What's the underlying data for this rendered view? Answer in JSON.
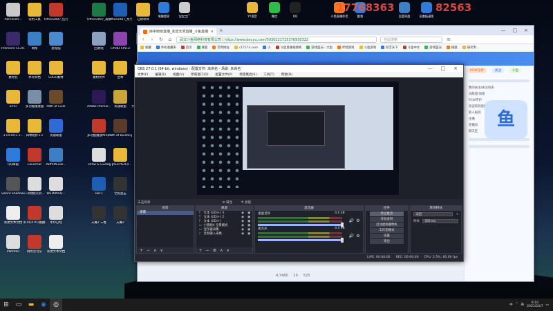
{
  "desktop": {
    "icons": [
      {
        "label": "Administr...",
        "color": "#c9c9c9"
      },
      {
        "label": "常用工具",
        "color": "#e8b938"
      },
      {
        "label": "Office2007_红打印机",
        "color": "#c0392b"
      },
      {
        "label": "Office2007_表格",
        "color": "#1d7a45"
      },
      {
        "label": "Office2007_文字",
        "color": "#1e5fb5"
      },
      {
        "label": "已建项目",
        "color": "#e8b938"
      },
      {
        "label": "Premiere CC2019",
        "color": "#3a2a6a"
      },
      {
        "label": "网络",
        "color": "#3c7fc4"
      },
      {
        "label": "此电脑",
        "color": "#4a8bd0"
      },
      {
        "label": "回收站",
        "color": "#8aa2bf"
      },
      {
        "label": "CPUID CPU-Z",
        "color": "#8e44ad"
      },
      {
        "label": "version",
        "color": "#2f7bdc"
      },
      {
        "label": "素材包",
        "color": "#e8b938"
      },
      {
        "label": "水印文档",
        "color": "#e8b938"
      },
      {
        "label": "LOGO素材",
        "color": "#e8b938"
      },
      {
        "label": "素材文件",
        "color": "#e8b938"
      },
      {
        "label": "台本",
        "color": "#e8b938"
      },
      {
        "label": "成片",
        "color": "#e8b938"
      },
      {
        "label": "error",
        "color": "#e8b938"
      },
      {
        "label": "多功能播放器",
        "color": "#7b8ea8"
      },
      {
        "label": "Path of Exile",
        "color": "#6b4a2a"
      },
      {
        "label": "Adobe Premie...",
        "color": "#2b1a55"
      },
      {
        "label": "英雄联盟",
        "color": "#c9a53a"
      },
      {
        "label": "文字过滤下载地址",
        "color": "#e8b938"
      },
      {
        "label": "3.14.0c(3.1...",
        "color": "#e8b938"
      },
      {
        "label": "四季防护3.1",
        "color": "#e8b938"
      },
      {
        "label": "英雄联盟",
        "color": "#2f6bd6"
      },
      {
        "label": "多功能播放AH(20.19...",
        "color": "#c0392b"
      },
      {
        "label": "Path of Building",
        "color": "#5a3a2a"
      },
      {
        "label": "PoeCharm",
        "color": "#c0392b"
      },
      {
        "label": "QQ邮箱",
        "color": "#2f7bdc"
      },
      {
        "label": "Launcher",
        "color": "#c0392b"
      },
      {
        "label": "PathOfExile...",
        "color": "#3c7fc4"
      },
      {
        "label": "Draw & Guess",
        "color": "#ddd"
      },
      {
        "label": "g.p%2F%2F(I...",
        "color": "#e8b938"
      },
      {
        "label": "QQ 浏览器",
        "color": "#2f7bdc"
      },
      {
        "label": "Sekiro Shadows",
        "color": "#555"
      },
      {
        "label": "~$网络识别...",
        "color": "#ddd"
      },
      {
        "label": "WEIXINGQ...",
        "color": "#ddd"
      },
      {
        "label": "Doc1",
        "color": "#1e5fb5"
      },
      {
        "label": "全民狙击",
        "color": "#333"
      },
      {
        "label": "For Honor",
        "color": "#8b1e1e"
      },
      {
        "label": "新建文本文档",
        "color": "#eee"
      },
      {
        "label": "(8.0)(4.01)麒麟...",
        "color": "#c0392b"
      },
      {
        "label": "水印已经",
        "color": "#ddd"
      },
      {
        "label": "天翼2 三维",
        "color": "#333"
      },
      {
        "label": "天翼2",
        "color": "#333"
      },
      {
        "label": "芒果TV",
        "color": "#f08a24"
      },
      {
        "label": "PW0000",
        "color": "#ddd"
      },
      {
        "label": "网易云音乐",
        "color": "#c0392b"
      },
      {
        "label": "新建文本文档",
        "color": "#eee"
      }
    ],
    "top_icons": [
      {
        "label": "电脑管家",
        "color": "#2f7bdc"
      },
      {
        "label": "宝宝工厂",
        "color": "#cccccc"
      },
      {
        "label": "YY语音",
        "color": "#e8b938"
      },
      {
        "label": "微信",
        "color": "#2dbb4e"
      },
      {
        "label": "QQ",
        "color": "#222222"
      },
      {
        "label": "斗鱼直播伴侣",
        "color": "#f27a1a"
      },
      {
        "label": "酷我",
        "color": "#2f7bdc"
      },
      {
        "label": "百度网盘",
        "color": "#3c7fc4"
      },
      {
        "label": "迅雷极速版",
        "color": "#2f7bdc"
      }
    ],
    "overlay_text_1": "17768363",
    "overlay_text_2": "82563"
  },
  "browser": {
    "tab_title": "房中晓晓直播_永劫无间直播_斗鱼直播",
    "url": "武汉斗鱼网络科技有限公司 | https://www.douyu.com/5030221715376930322",
    "search_placeholder": "在此搜索",
    "bookmarks": [
      "收藏",
      "手机收藏夹",
      "首页",
      "搜狐",
      "常用网址",
      "c17173.com",
      "小",
      "斗鱼直播视频网",
      "游戏盛况 - 大鱼",
      "哔哩游戏",
      "斗鱼游戏",
      "综艺天下",
      "斗鱼中文",
      "游戏盛况",
      "搜狐",
      "研究专..."
    ],
    "side_text": [
      "我的关注/关注列表",
      "贡献值/周榜",
      "PCW守护",
      "欢迎来到直播间",
      "新人报到",
      "主播",
      "直播间",
      "聊天区"
    ],
    "side_pills": [
      "PCW守护",
      "关注",
      "斗鱼"
    ],
    "big_logo": "鱼",
    "footer": [
      "4,7486",
      "20",
      "520"
    ]
  },
  "obs": {
    "title": "OBS 27.0.1 (64-bit, windows) - 配置文件: 未命名 - 场景: 未命名",
    "menu": [
      "文件(F)",
      "编辑(E)",
      "视图(V)",
      "停靠窗口(D)",
      "配置文件(P)",
      "场景集合(S)",
      "工具(T)",
      "帮助(H)"
    ],
    "no_source": "未选择源",
    "props_label": "属性",
    "filter_label": "滤镜",
    "docks": {
      "scenes": {
        "title": "场景",
        "items": [
          "场景"
        ]
      },
      "sources": {
        "title": "来源",
        "items": [
          {
            "icon": "T",
            "label": "文本 (GDI+) 3"
          },
          {
            "icon": "T",
            "label": "文本 (GDI+) 2"
          },
          {
            "icon": "T",
            "label": "文本 (GDI+)"
          },
          {
            "icon": "▭",
            "label": "小钢炮4 全景模式"
          },
          {
            "icon": "▭",
            "label": "显示器采集"
          },
          {
            "icon": "♪",
            "label": "音频输入采集"
          }
        ]
      },
      "mixer": {
        "title": "混音器",
        "channels": [
          {
            "label": "桌面音频",
            "db": "0.0 dB"
          },
          {
            "label": "麦克风",
            "db": "0.0 dB"
          }
        ]
      },
      "transitions": {
        "title": "转场特效",
        "type": "淡出",
        "duration_label": "时长",
        "duration": "300 ms"
      },
      "controls": {
        "title": "控件",
        "buttons": [
          "停止推流",
          "开始录制",
          "启动虚拟摄像机",
          "工作室模式",
          "设置",
          "退出"
        ]
      }
    },
    "status": [
      "LIVE: 00:00:00",
      "REC: 00:00:00",
      "CPU: 2.5%, 60.00 fps"
    ]
  },
  "taskbar": {
    "time": "9:10",
    "date": "2021/10/7",
    "tray": [
      "中",
      "⌃",
      "英"
    ]
  }
}
